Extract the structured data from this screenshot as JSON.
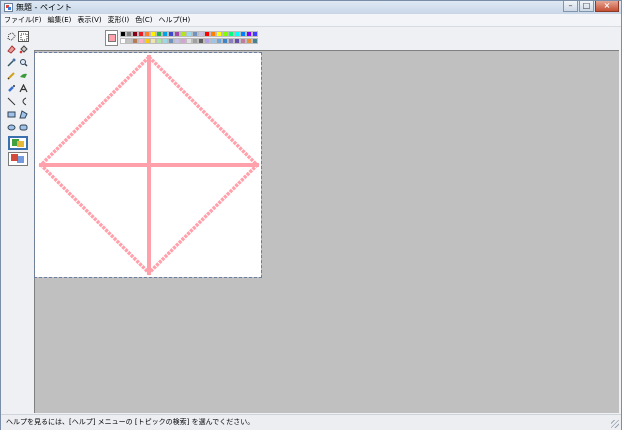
{
  "window": {
    "title": "無題 - ペイント"
  },
  "menu": [
    "ファイル(F)",
    "編集(E)",
    "表示(V)",
    "変形(I)",
    "色(C)",
    "ヘルプ(H)"
  ],
  "tools": [
    "free-form-select",
    "select",
    "eraser",
    "fill-with-color",
    "pick-color",
    "magnifier",
    "pencil",
    "brush",
    "airbrush",
    "text",
    "line",
    "curve",
    "rectangle",
    "polygon",
    "ellipse",
    "rounded-rectangle"
  ],
  "tool_options": [
    "opaque-background",
    "transparent-background"
  ],
  "palette": {
    "foreground": "#ffa0ab",
    "background": "#ffffff",
    "row1": [
      "#000000",
      "#7f7f7f",
      "#880015",
      "#ed1c24",
      "#ff7f27",
      "#fff200",
      "#22b14c",
      "#00a2e8",
      "#3f48cc",
      "#a349a4",
      "#b5e61d",
      "#99d9ea",
      "#7092be",
      "#c8bfe7",
      "#ff0000",
      "#ff8000",
      "#ffff00",
      "#80ff00",
      "#00ff80",
      "#00ffff",
      "#0080ff",
      "#8000ff",
      "#4040ff"
    ],
    "row2": [
      "#ffffff",
      "#c3c3c3",
      "#b97a57",
      "#ffaec9",
      "#ffc90e",
      "#efe4b0",
      "#a8e6a1",
      "#99d9ea",
      "#7092be",
      "#c8bfe7",
      "#d6a3d6",
      "#e0e0e0",
      "#a0a0a0",
      "#606060",
      "#b4a2e8",
      "#9dc3e6",
      "#6fa8dc",
      "#3d85c6",
      "#8e7cc3",
      "#674ea7",
      "#c27ba0",
      "#e69138",
      "#45818e"
    ]
  },
  "drawing": {
    "stroke_color": "#ffa0ab",
    "shape": "diamond-with-cross"
  },
  "status": {
    "text": "ヘルプを見るには、[ヘルプ] メニューの [トピックの検索] を選んでください。"
  }
}
